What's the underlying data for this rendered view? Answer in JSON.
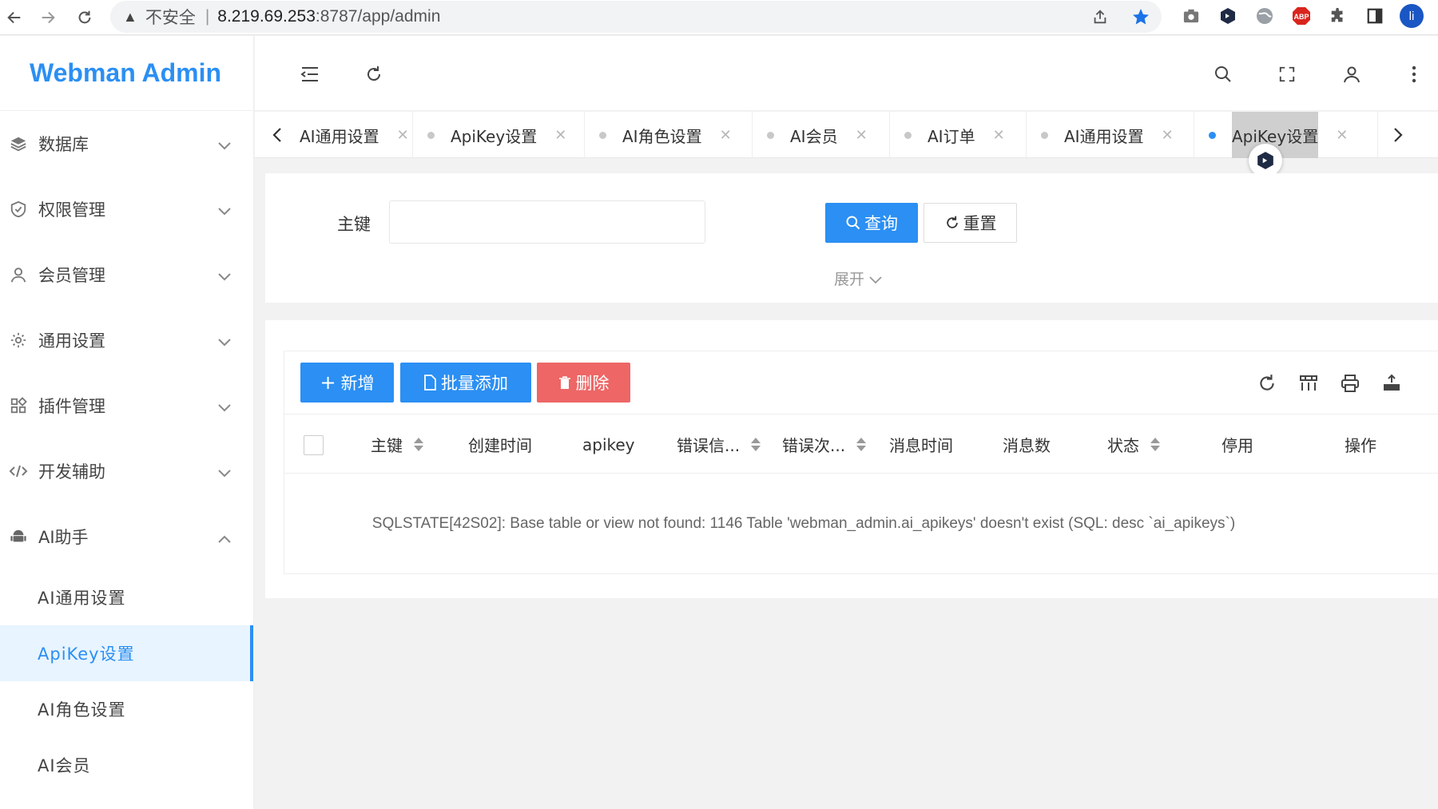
{
  "browser": {
    "insecure_label": "不安全",
    "url_host": "8.219.69.253",
    "url_rest": ":8787/app/admin",
    "avatar_letter": "li",
    "abp_label": "ABP"
  },
  "app": {
    "title": "Webman Admin"
  },
  "sidebar": {
    "items": [
      {
        "label": "数据库"
      },
      {
        "label": "权限管理"
      },
      {
        "label": "会员管理"
      },
      {
        "label": "通用设置"
      },
      {
        "label": "插件管理"
      },
      {
        "label": "开发辅助"
      },
      {
        "label": "AI助手"
      }
    ],
    "subitems": [
      {
        "label": "AI通用设置"
      },
      {
        "label": "ApiKey设置"
      },
      {
        "label": "AI角色设置"
      },
      {
        "label": "AI会员"
      }
    ]
  },
  "tabs": [
    {
      "label": "AI通用设置"
    },
    {
      "label": "ApiKey设置"
    },
    {
      "label": "AI角色设置"
    },
    {
      "label": "AI会员"
    },
    {
      "label": "AI订单"
    },
    {
      "label": "AI通用设置"
    },
    {
      "label": "ApiKey设置"
    }
  ],
  "search": {
    "field_label": "主键",
    "input_value": "",
    "query_label": "查询",
    "reset_label": "重置",
    "expand_label": "展开"
  },
  "toolbar": {
    "add_label": "新增",
    "batch_label": "批量添加",
    "delete_label": "删除"
  },
  "table": {
    "columns": [
      "主键",
      "创建时间",
      "apikey",
      "错误信...",
      "错误次...",
      "消息时间",
      "消息数",
      "状态",
      "停用",
      "操作"
    ],
    "message": "SQLSTATE[42S02]: Base table or view not found: 1146 Table 'webman_admin.ai_apikeys' doesn't exist (SQL: desc `ai_apikeys`)"
  },
  "colors": {
    "primary": "#2b8ff3",
    "danger": "#ee6666"
  }
}
